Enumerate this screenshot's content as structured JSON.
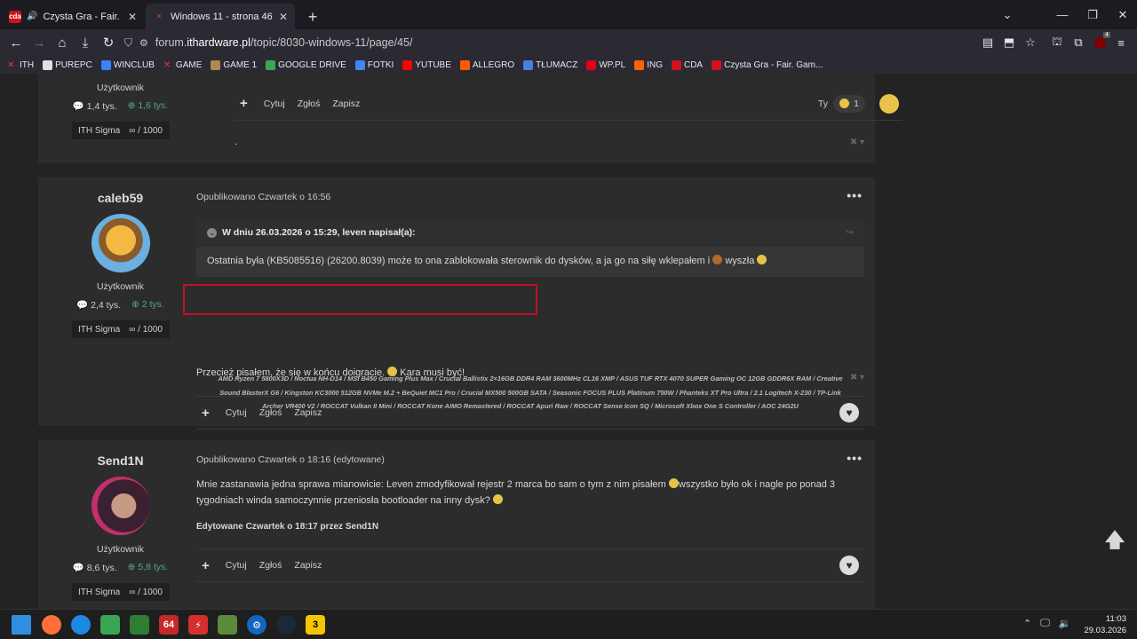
{
  "browser": {
    "tabs": [
      {
        "title": "Czysta Gra - Fair. Game (Ak",
        "favicon": "cda-icon",
        "audio": true,
        "active": false
      },
      {
        "title": "Windows 11 - strona 46 - Wind",
        "favicon": "ith-icon",
        "audio": false,
        "active": true
      }
    ],
    "url_prefix": "forum.",
    "url_host": "ithardware.pl",
    "url_path": "/topic/8030-windows-11/page/45/",
    "extension_badge": "4",
    "bookmarks": [
      "ITH",
      "PUREPC",
      "WINCLUB",
      "GAME",
      "GAME 1",
      "GOOGLE DRIVE",
      "FOTKI",
      "YUTUBE",
      "ALLEGRO",
      "TŁUMACZ",
      "WP.PL",
      "ING",
      "CDA",
      "Czysta Gra - Fair. Gam..."
    ]
  },
  "post0": {
    "role": "Użytkownik",
    "posts": "1,4 tys.",
    "rep": "1,6 tys.",
    "sigma": "ITH Sigma",
    "sigma_value": "∞ / 1000",
    "actions": [
      "Cytuj",
      "Zgłoś",
      "Zapisz"
    ],
    "reaction_label": "Ty",
    "reaction_count": "1",
    "signature": "."
  },
  "post1": {
    "author": "caleb59",
    "role": "Użytkownik",
    "posts": "2,4 tys.",
    "rep": "2 tys.",
    "sigma": "ITH Sigma",
    "sigma_value": "∞ / 1000",
    "meta": "Opublikowano Czwartek o 16:56",
    "quote_head": "W dniu 26.03.2026 o 15:29, leven napisał(a):",
    "quote_text": "Ostatnia była (KB5085516) (26200.8039) może to ona zablokowała sterownik do dysków, a ja go na siłę wklepałem i",
    "quote_tail": "wyszła",
    "text_a": "Przecież pisałem, że się w końcu doigracie.",
    "text_b": "Kara musi być!",
    "actions": [
      "Cytuj",
      "Zgłoś",
      "Zapisz"
    ],
    "signature": [
      "AMD Ryzen 7 5800X3D / Noctua NH-D14 / MSI B450 Gaming Plus Max / Crucial Ballistix 2×16GB DDR4 RAM 3600MHz CL16 XMP / ASUS TUF RTX 4070 SUPER Gaming OC 12GB GDDR6X RAM / Creative",
      "Sound BlasterX G6 / Kingston KC3000 512GB NVMe M.2 + BeQuiet MC1 Pro / Crucial MX500 500GB SATA / Seasonic FOCUS PLUS Platinum 750W / Phanteks XT Pro Ultra / 2.1 Logitech X-230 / TP-Link",
      "Archer VR400 V2 / ROCCAT Vulkan II Mini / ROCCAT Kone AIMO Remastered / ROCCAT Apuri Raw / ROCCAT Sense Icon SQ / Microsoft Xbox One S Controller / AOC 24G2U"
    ]
  },
  "post2": {
    "author": "Send1N",
    "role": "Użytkownik",
    "posts": "8,6 tys.",
    "rep": "5,8 tys.",
    "sigma": "ITH Sigma",
    "sigma_value": "∞ / 1000",
    "meta": "Opublikowano Czwartek o 18:16 (edytowane)",
    "text_a": "Mnie zastanawia jedna sprawa mianowicie: Leven zmodyfikował rejestr 2 marca bo sam o tym z nim pisałem",
    "text_b": "wszystko było ok i nagle po ponad 3",
    "text_c": "tygodniach winda samoczynnie przeniosła bootloader na inny dysk?",
    "edited": "Edytowane Czwartek o 18:17 przez Send1N",
    "actions": [
      "Cytuj",
      "Zgłoś",
      "Zapisz"
    ]
  },
  "clock": {
    "time": "11:03",
    "date": "29.03.2026"
  },
  "colors": {
    "accent_red": "#c1121f",
    "rep_green": "#58a77f",
    "post_bg": "#2c2c2c",
    "page_bg": "#232323"
  }
}
